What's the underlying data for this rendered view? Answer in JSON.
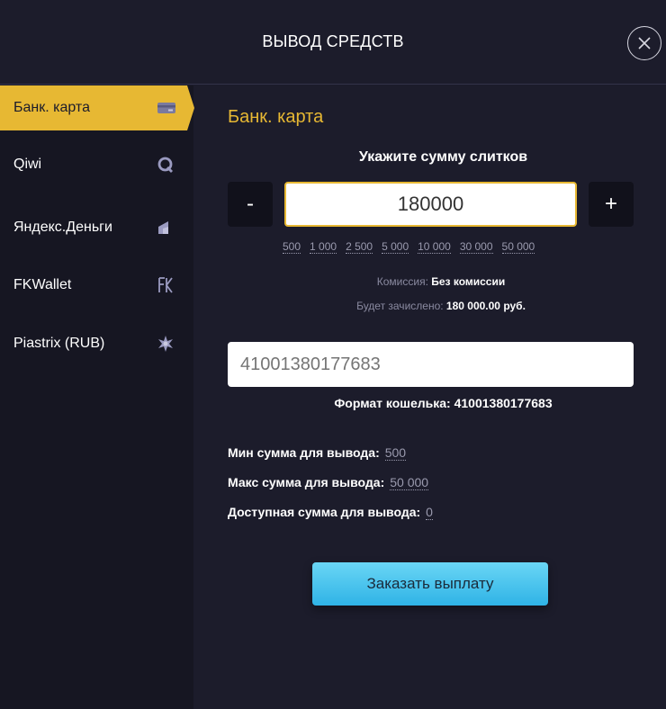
{
  "header": {
    "title": "ВЫВОД СРЕДСТВ"
  },
  "sidebar": {
    "items": [
      {
        "label": "Банк. карта",
        "icon": "credit-card-icon",
        "active": true
      },
      {
        "label": "Qiwi",
        "icon": "qiwi-icon",
        "active": false
      },
      {
        "label": "Яндекс.Деньги",
        "icon": "yandex-money-icon",
        "active": false
      },
      {
        "label": "FKWallet",
        "icon": "fkwallet-icon",
        "active": false
      },
      {
        "label": "Piastrix (RUB)",
        "icon": "piastrix-icon",
        "active": false
      }
    ]
  },
  "main": {
    "section_title": "Банк. карта",
    "amount_hint": "Укажите сумму слитков",
    "minus_label": "-",
    "plus_label": "+",
    "amount_value": "180000",
    "presets": [
      "500",
      "1 000",
      "2 500",
      "5 000",
      "10 000",
      "30 000",
      "50 000"
    ],
    "commission_label": "Комиссия:",
    "commission_value": "Без комиссии",
    "credited_label": "Будет зачислено:",
    "credited_value": "180 000.00 руб.",
    "wallet_placeholder": "41001380177683",
    "wallet_format": "Формат кошелька: 41001380177683",
    "limits": [
      {
        "label": "Мин сумма для вывода:",
        "value": "500"
      },
      {
        "label": "Макс сумма для вывода:",
        "value": "50 000"
      },
      {
        "label": "Доступная сумма для вывода:",
        "value": "0"
      }
    ],
    "submit_label": "Заказать выплату"
  },
  "colors": {
    "accent": "#e7b833",
    "background": "#1c1c2b",
    "sidebar": "#161622",
    "button": "#3fc0ee"
  }
}
